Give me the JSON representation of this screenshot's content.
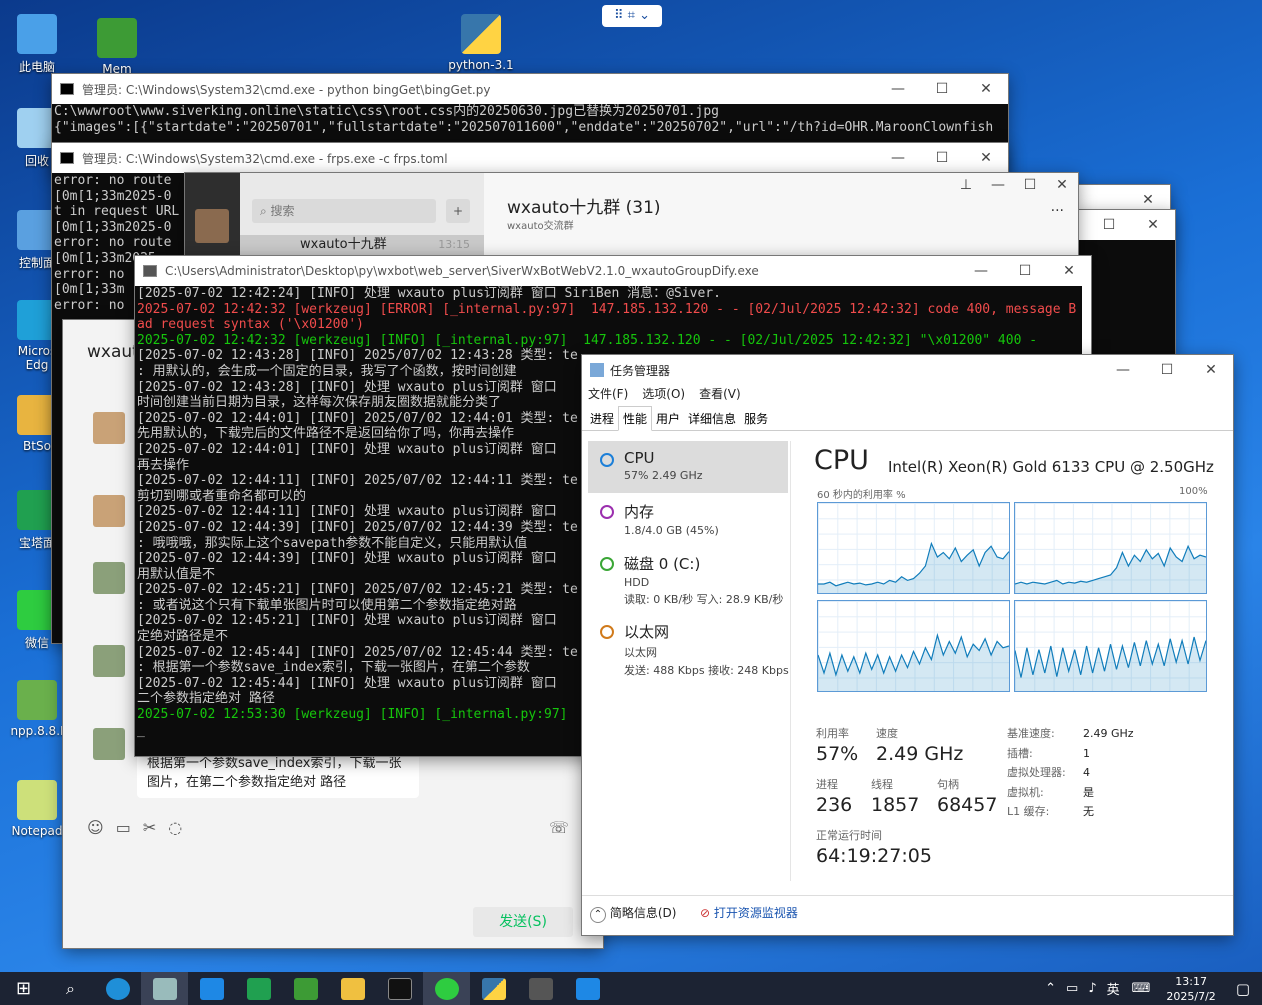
{
  "desktop": {
    "icons": [
      {
        "label": "此电脑",
        "color": "#4aa0e8"
      },
      {
        "label": "回收",
        "color": "#9fd0f0"
      },
      {
        "label": "控制面",
        "color": "#5aa0e0"
      },
      {
        "label": "Micros Edg",
        "color": "#1fa0d8"
      },
      {
        "label": "BtSo",
        "color": "#e8b440"
      },
      {
        "label": "宝塔面",
        "color": "#20a050"
      },
      {
        "label": "微信",
        "color": "#2ecc40"
      },
      {
        "label": "npp.8.8.I",
        "color": "#6ab04c"
      },
      {
        "label": "Notepad",
        "color": "#cde07a"
      }
    ],
    "icon_mem": "Mem",
    "icon_python": "python-3.1"
  },
  "snap": {
    "label": "⠿ ⌗ ⌄"
  },
  "cmd1": {
    "title": "管理员: C:\\Windows\\System32\\cmd.exe - python  bingGet\\bingGet.py",
    "lines": [
      "C:\\wwwroot\\www.siverking.online\\static\\css\\root.css内的20250630.jpg已替换为20250701.jpg",
      "{\"images\":[{\"startdate\":\"20250701\",\"fullstartdate\":\"202507011600\",\"enddate\":\"20250702\",\"url\":\"/th?id=OHR.MaroonClownfish"
    ]
  },
  "cmd2": {
    "title": "管理员: C:\\Windows\\System32\\cmd.exe - frps.exe  -c frps.toml",
    "lines": [
      "error: no route",
      "[0m[1;33m2025-0",
      "t in request URL",
      "[0m[1;33m2025-0",
      "error: no route",
      "[0m[1;33m2025",
      "error: no",
      "[0m[1;33m",
      "error: no"
    ]
  },
  "wechat": {
    "search_placeholder": "搜索",
    "chat_title": "wxauto十九群 (31)",
    "chat_sub": "wxauto交流群",
    "list_item": "wxauto十九群",
    "list_time": "13:15",
    "back_title": "wxaut",
    "bubble": "根据第一个参数save_index索引，下载一张图片，在第二个参数指定绝对 路径",
    "send_label": "发送(S)"
  },
  "bot": {
    "title": "C:\\Users\\Administrator\\Desktop\\py\\wxbot\\web_server\\SiverWxBotWebV2.1.0_wxautoGroupDify.exe",
    "lines": [
      {
        "t": "[2025-07-02 12:42:24] [INFO] 处理 wxauto plus订阅群 窗口 SiriBen 消息：@Siver.",
        "c": ""
      },
      {
        "t": "2025-07-02 12:42:32 [werkzeug] [ERROR] [_internal.py:97]  147.185.132.120 - - [02/Jul/2025 12:42:32] code 400, message B",
        "c": "red"
      },
      {
        "t": "ad request syntax ('\\x01200')",
        "c": "red"
      },
      {
        "t": "2025-07-02 12:42:32 [werkzeug] [INFO] [_internal.py:97]  147.185.132.120 - - [02/Jul/2025 12:42:32] \"\\x01200\" 400 -",
        "c": "grn"
      },
      {
        "t": "[2025-07-02 12:43:28] [INFO] 2025/07/02 12:43:28 类型: te",
        "c": ""
      },
      {
        "t": ": 用默认的，会生成一个固定的目录，我写了个函数，按时间创建",
        "c": ""
      },
      {
        "t": "[2025-07-02 12:43:28] [INFO] 处理 wxauto plus订阅群 窗口",
        "c": ""
      },
      {
        "t": "时间创建当前日期为目录，这样每次保存朋友圈数据就能分类了",
        "c": ""
      },
      {
        "t": "[2025-07-02 12:44:01] [INFO] 2025/07/02 12:44:01 类型: te",
        "c": ""
      },
      {
        "t": "先用默认的，下载完后的文件路径不是返回给你了吗，你再去操作",
        "c": ""
      },
      {
        "t": "[2025-07-02 12:44:01] [INFO] 处理 wxauto plus订阅群 窗口",
        "c": ""
      },
      {
        "t": "再去操作",
        "c": ""
      },
      {
        "t": "[2025-07-02 12:44:11] [INFO] 2025/07/02 12:44:11 类型: te",
        "c": ""
      },
      {
        "t": "剪切到哪或者重命名都可以的",
        "c": ""
      },
      {
        "t": "[2025-07-02 12:44:11] [INFO] 处理 wxauto plus订阅群 窗口",
        "c": ""
      },
      {
        "t": "[2025-07-02 12:44:39] [INFO] 2025/07/02 12:44:39 类型: te",
        "c": ""
      },
      {
        "t": ": 哦哦哦，那实际上这个savepath参数不能自定义，只能用默认值",
        "c": ""
      },
      {
        "t": "[2025-07-02 12:44:39] [INFO] 处理 wxauto plus订阅群 窗口",
        "c": ""
      },
      {
        "t": "用默认值是不",
        "c": ""
      },
      {
        "t": "[2025-07-02 12:45:21] [INFO] 2025/07/02 12:45:21 类型: te",
        "c": ""
      },
      {
        "t": ": 或者说这个只有下载单张图片时可以使用第二个参数指定绝对路",
        "c": ""
      },
      {
        "t": "[2025-07-02 12:45:21] [INFO] 处理 wxauto plus订阅群 窗口",
        "c": ""
      },
      {
        "t": "定绝对路径是不",
        "c": ""
      },
      {
        "t": "[2025-07-02 12:45:44] [INFO] 2025/07/02 12:45:44 类型: te",
        "c": ""
      },
      {
        "t": ": 根据第一个参数save_index索引，下载一张图片，在第二个参数",
        "c": ""
      },
      {
        "t": "[2025-07-02 12:45:44] [INFO] 处理 wxauto plus订阅群 窗口",
        "c": ""
      },
      {
        "t": "二个参数指定绝对 路径",
        "c": ""
      },
      {
        "t": "2025-07-02 12:53:30 [werkzeug] [INFO] [_internal.py:97]",
        "c": "grn"
      },
      {
        "t": "_",
        "c": ""
      }
    ]
  },
  "tm": {
    "title": "任务管理器",
    "menu": [
      "文件(F)",
      "选项(O)",
      "查看(V)"
    ],
    "tabs": [
      "进程",
      "性能",
      "用户",
      "详细信息",
      "服务"
    ],
    "side": [
      {
        "name": "CPU",
        "sub": "57%  2.49 GHz",
        "color": "#1c7fd8"
      },
      {
        "name": "内存",
        "sub": "1.8/4.0 GB (45%)",
        "color": "#9b2fae"
      },
      {
        "name": "磁盘 0 (C:)",
        "sub": "HDD",
        "sub2": "读取: 0 KB/秒  写入: 28.9 KB/秒",
        "color": "#3aa636"
      },
      {
        "name": "以太网",
        "sub": "以太网",
        "sub2": "发送: 488 Kbps  接收: 248 Kbps",
        "color": "#d07a1b"
      }
    ],
    "cpu_title": "CPU",
    "cpu_model": "Intel(R) Xeon(R) Gold 6133 CPU @ 2.50GHz",
    "graph_label": "60 秒内的利用率 %",
    "graph_max": "100%",
    "util_label": "利用率",
    "util": "57%",
    "speed_label": "速度",
    "speed": "2.49 GHz",
    "proc_label": "进程",
    "proc": "236",
    "thread_label": "线程",
    "thread": "1857",
    "handle_label": "句柄",
    "handle": "68457",
    "uptime_label": "正常运行时间",
    "uptime": "64:19:27:05",
    "kv": [
      [
        "基准速度:",
        "2.49 GHz"
      ],
      [
        "插槽:",
        "1"
      ],
      [
        "虚拟处理器:",
        "4"
      ],
      [
        "虚拟机:",
        "是"
      ],
      [
        "L1 缓存:",
        "无"
      ]
    ],
    "brief": "简略信息(D)",
    "monitor": "打开资源监视器",
    "graphs": [
      [
        10,
        10,
        12,
        8,
        10,
        12,
        10,
        11,
        9,
        10,
        12,
        10,
        14,
        12,
        18,
        14,
        16,
        22,
        30,
        55,
        40,
        45,
        38,
        50,
        35,
        42,
        48,
        30,
        45,
        52,
        40,
        38,
        46
      ],
      [
        10,
        12,
        10,
        12,
        11,
        10,
        12,
        14,
        10,
        12,
        11,
        13,
        12,
        14,
        16,
        18,
        20,
        28,
        45,
        30,
        42,
        35,
        48,
        38,
        44,
        30,
        50,
        40,
        35,
        52,
        38,
        42,
        40
      ],
      [
        40,
        20,
        42,
        18,
        40,
        22,
        38,
        20,
        42,
        24,
        40,
        20,
        38,
        22,
        40,
        26,
        44,
        30,
        48,
        35,
        62,
        40,
        55,
        42,
        60,
        38,
        52,
        45,
        58,
        40,
        55,
        48,
        50
      ],
      [
        45,
        15,
        48,
        18,
        46,
        20,
        50,
        16,
        48,
        22,
        46,
        18,
        50,
        20,
        48,
        22,
        52,
        24,
        50,
        26,
        54,
        28,
        56,
        30,
        52,
        28,
        58,
        32,
        56,
        30,
        60,
        34,
        56
      ]
    ]
  },
  "taskbar": {
    "time": "13:17",
    "date": "2025/7/2",
    "ime": "英"
  }
}
